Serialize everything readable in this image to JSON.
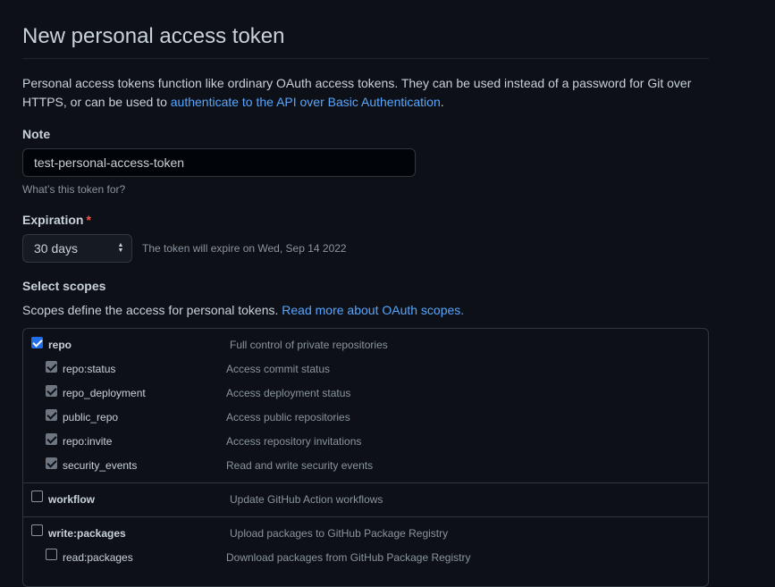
{
  "header": {
    "title": "New personal access token"
  },
  "intro": {
    "text_before": "Personal access tokens function like ordinary OAuth access tokens. They can be used instead of a password for Git over HTTPS, or can be used to ",
    "link_text": "authenticate to the API over Basic Authentication",
    "text_after": "."
  },
  "note": {
    "label": "Note",
    "value": "test-personal-access-token",
    "hint": "What’s this token for?"
  },
  "expiration": {
    "label": "Expiration",
    "required_marker": "*",
    "selected": "30 days",
    "expiry_text": "The token will expire on Wed, Sep 14 2022"
  },
  "scopes": {
    "label": "Select scopes",
    "description": "Scopes define the access for personal tokens. ",
    "link_text": "Read more about OAuth scopes.",
    "groups": [
      {
        "name": "repo",
        "description": "Full control of private repositories",
        "checked": true,
        "children": [
          {
            "name": "repo:status",
            "description": "Access commit status",
            "checked": true
          },
          {
            "name": "repo_deployment",
            "description": "Access deployment status",
            "checked": true
          },
          {
            "name": "public_repo",
            "description": "Access public repositories",
            "checked": true
          },
          {
            "name": "repo:invite",
            "description": "Access repository invitations",
            "checked": true
          },
          {
            "name": "security_events",
            "description": "Read and write security events",
            "checked": true
          }
        ]
      },
      {
        "name": "workflow",
        "description": "Update GitHub Action workflows",
        "checked": false,
        "children": []
      },
      {
        "name": "write:packages",
        "description": "Upload packages to GitHub Package Registry",
        "checked": false,
        "children": [
          {
            "name": "read:packages",
            "description": "Download packages from GitHub Package Registry",
            "checked": false
          }
        ]
      }
    ]
  },
  "colors": {
    "background": "#0d1117",
    "text": "#c9d1d9",
    "muted": "#8b949e",
    "link": "#58a6ff",
    "border": "#30363d",
    "checkbox_checked": "#1f6feb",
    "required": "#f85149"
  }
}
